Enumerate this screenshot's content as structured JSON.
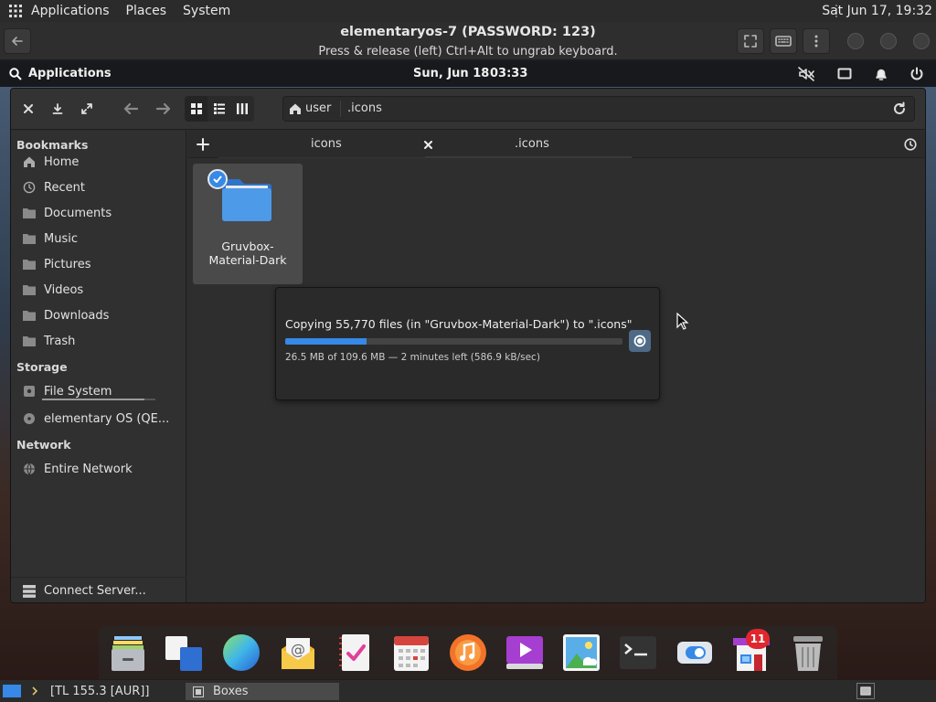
{
  "host_top": {
    "menus": [
      "Applications",
      "Places",
      "System"
    ],
    "clock": "Sat Jun 17, 19:32",
    "apps_icon": "grid-icon"
  },
  "boxes_bar": {
    "title": "elementaryos-7 (PASSWORD: 123)",
    "hint": "Press & release (left) Ctrl+Alt to ungrab keyboard.",
    "buttons": [
      "back-arrow-icon",
      "fullscreen-icon",
      "keyboard-icon",
      "menu-dots-icon"
    ]
  },
  "guest_panel": {
    "applications": "Applications",
    "date": "Sun, Jun 18",
    "time": "03:33",
    "indicators": [
      "muted-speaker-icon",
      "display-icon",
      "notifications-icon",
      "power-icon"
    ]
  },
  "files": {
    "toolbar_icons": [
      "close-icon",
      "download-icon",
      "expand-icon",
      "back-arrow-icon",
      "forward-arrow-icon",
      "grid-view-icon",
      "list-view-icon",
      "column-view-icon"
    ],
    "path": {
      "home": "user",
      "current": ".icons"
    },
    "sidebar": {
      "bookmarks_heading": "Bookmarks",
      "bookmarks": [
        {
          "label": "Home",
          "icon": "home-icon"
        },
        {
          "label": "Recent",
          "icon": "clock-icon"
        },
        {
          "label": "Documents",
          "icon": "folder-icon"
        },
        {
          "label": "Music",
          "icon": "folder-icon"
        },
        {
          "label": "Pictures",
          "icon": "folder-icon"
        },
        {
          "label": "Videos",
          "icon": "folder-icon"
        },
        {
          "label": "Downloads",
          "icon": "folder-icon"
        },
        {
          "label": "Trash",
          "icon": "trash-icon"
        }
      ],
      "storage_heading": "Storage",
      "storage": [
        {
          "label": "File System",
          "icon": "drive-icon",
          "usage_fraction": 0.9
        },
        {
          "label": "elementary OS (QE...",
          "icon": "disc-icon"
        }
      ],
      "network_heading": "Network",
      "network": [
        {
          "label": "Entire Network",
          "icon": "network-icon"
        }
      ],
      "connect_server": "Connect Server..."
    },
    "tabs": [
      {
        "label": "icons"
      },
      {
        "label": ".icons"
      }
    ],
    "items": [
      {
        "name": "Gruvbox-Material-Dark",
        "name_line1": "Gruvbox-",
        "name_line2": "Material-Dark"
      }
    ],
    "progress": {
      "message": "Copying 55,770 files (in \"Gruvbox-Material-Dark\") to \".icons\"",
      "fraction": 0.24,
      "detail": "26.5 MB of 109.6 MB — 2 minutes left (586.9 kB/sec)"
    }
  },
  "dock": {
    "apps": [
      "files-icon",
      "multitasking-icon",
      "web-browser-icon",
      "mail-icon",
      "tasks-icon",
      "calendar-icon",
      "music-icon",
      "videos-icon",
      "photos-icon",
      "terminal-icon",
      "settings-icon",
      "appcenter-icon",
      "trash-icon"
    ],
    "appcenter_badge": "11"
  },
  "host_bottom": {
    "task1": "[TL 155.3 [AUR]]",
    "task2": "Boxes"
  },
  "colors": {
    "accent": "#3689e6",
    "badge": "#e0272e"
  }
}
